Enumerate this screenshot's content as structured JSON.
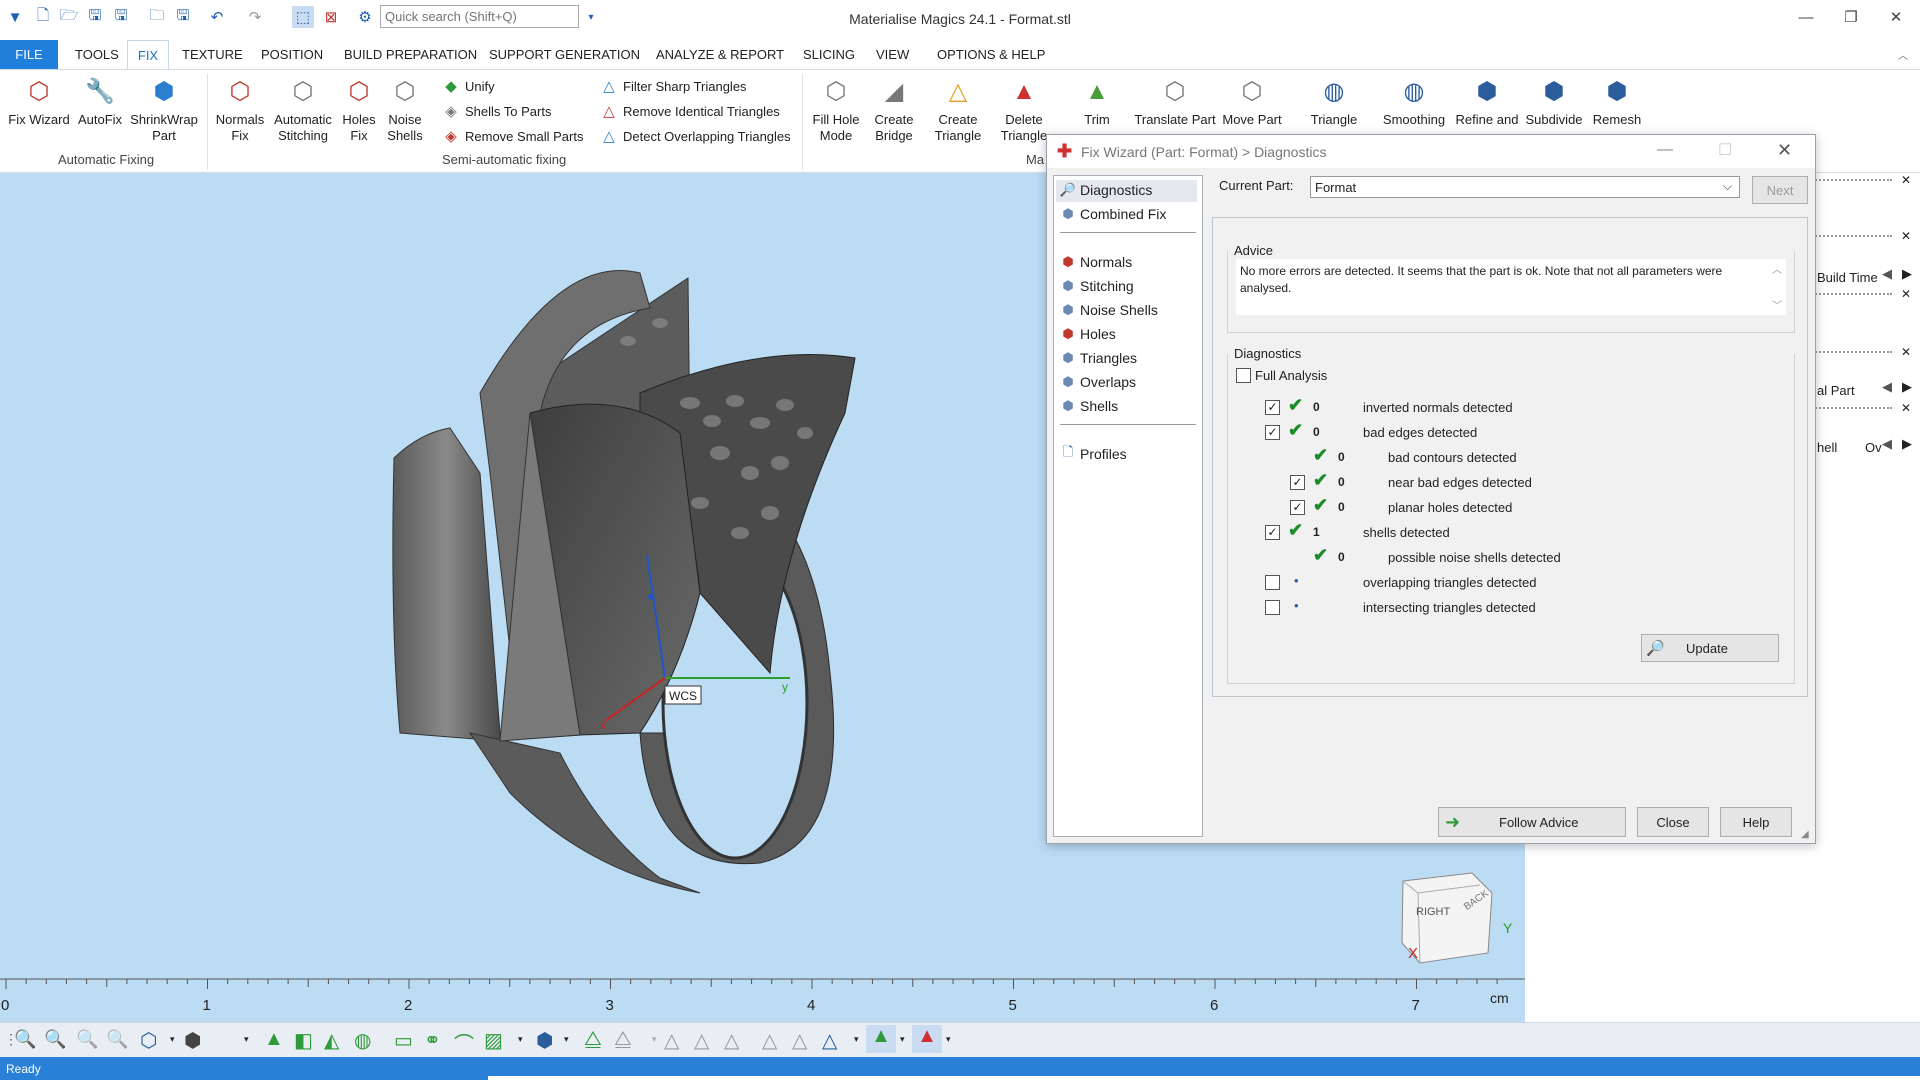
{
  "app": {
    "title": "Materialise Magics 24.1 - Format.stl",
    "search_placeholder": "Quick search (Shift+Q)"
  },
  "menu": {
    "file": "FILE",
    "tools": "TOOLS",
    "fix": "FIX",
    "texture": "TEXTURE",
    "position": "POSITION",
    "build_preparation": "BUILD PREPARATION",
    "support_generation": "SUPPORT GENERATION",
    "analyze_report": "ANALYZE & REPORT",
    "slicing": "SLICING",
    "view": "VIEW",
    "options_help": "OPTIONS & HELP"
  },
  "ribbon": {
    "fix_wizard": "Fix Wizard",
    "autofix": "AutoFix",
    "shrinkwrap_1": "ShrinkWrap",
    "shrinkwrap_2": "Part",
    "normals_1": "Normals",
    "normals_2": "Fix",
    "auto_stitching_1": "Automatic",
    "auto_stitching_2": "Stitching",
    "holes_1": "Holes",
    "holes_2": "Fix",
    "noise_1": "Noise",
    "noise_2": "Shells",
    "unify": "Unify",
    "shells_to_parts": "Shells To Parts",
    "remove_small_parts": "Remove Small Parts",
    "filter_sharp": "Filter Sharp Triangles",
    "remove_identical": "Remove Identical Triangles",
    "detect_overlapping": "Detect Overlapping Triangles",
    "fill_hole_1": "Fill Hole",
    "fill_hole_2": "Mode",
    "create_bridge_1": "Create",
    "create_bridge_2": "Bridge",
    "create_triangle_1": "Create",
    "create_triangle_2": "Triangle",
    "delete_triangle_1": "Delete",
    "delete_triangle_2": "Triangle",
    "trim": "Trim",
    "translate_part": "Translate Part",
    "move_part": "Move Part",
    "triangle": "Triangle",
    "smoothing": "Smoothing",
    "refine_and": "Refine and",
    "subdivide": "Subdivide",
    "remesh": "Remesh",
    "group_automatic": "Automatic Fixing",
    "group_semi": "Semi-automatic fixing",
    "group_ma": "Ma"
  },
  "viewport": {
    "wcs_label": "WCS",
    "cube_right": "RIGHT",
    "cube_back": "BACK",
    "axis_x": "X",
    "axis_y": "Y",
    "axis_y_small": "y",
    "axis_x_small": "x"
  },
  "ruler": {
    "ticks": [
      "0",
      "1",
      "2",
      "3",
      "4",
      "5",
      "6",
      "7"
    ],
    "unit": "cm"
  },
  "right_panel": {
    "build_time": "Build Time",
    "al_part": "al Part",
    "hell": "hell",
    "ov": "Ov"
  },
  "dialog": {
    "title": "Fix Wizard (Part: Format) > Diagnostics",
    "nav": {
      "diagnostics": "Diagnostics",
      "combined_fix": "Combined Fix",
      "normals": "Normals",
      "stitching": "Stitching",
      "noise_shells": "Noise Shells",
      "holes": "Holes",
      "triangles": "Triangles",
      "overlaps": "Overlaps",
      "shells": "Shells",
      "profiles": "Profiles"
    },
    "current_part_label": "Current Part:",
    "current_part_value": "Format",
    "next": "Next",
    "advice_label": "Advice",
    "advice_text": "No more errors are detected. It seems that the part is ok. Note that not all parameters were analysed.",
    "diagnostics_label": "Diagnostics",
    "full_analysis": "Full Analysis",
    "rows": [
      {
        "count": "0",
        "label": "inverted normals detected"
      },
      {
        "count": "0",
        "label": "bad edges detected"
      },
      {
        "count": "0",
        "label": "bad contours detected"
      },
      {
        "count": "0",
        "label": "near bad edges detected"
      },
      {
        "count": "0",
        "label": "planar holes detected"
      },
      {
        "count": "1",
        "label": "shells detected"
      },
      {
        "count": "0",
        "label": "possible noise shells detected"
      },
      {
        "count": "",
        "label": "overlapping triangles detected"
      },
      {
        "count": "",
        "label": "intersecting triangles detected"
      }
    ],
    "update": "Update",
    "follow_advice": "Follow Advice",
    "close": "Close",
    "help": "Help"
  },
  "status": {
    "text": "Ready"
  },
  "colors": {
    "accent": "#1f7fdb",
    "viewport_bg": "#bcdcf4",
    "statusbar": "#2a7fd6",
    "ok_tick": "#1a8c2a"
  }
}
